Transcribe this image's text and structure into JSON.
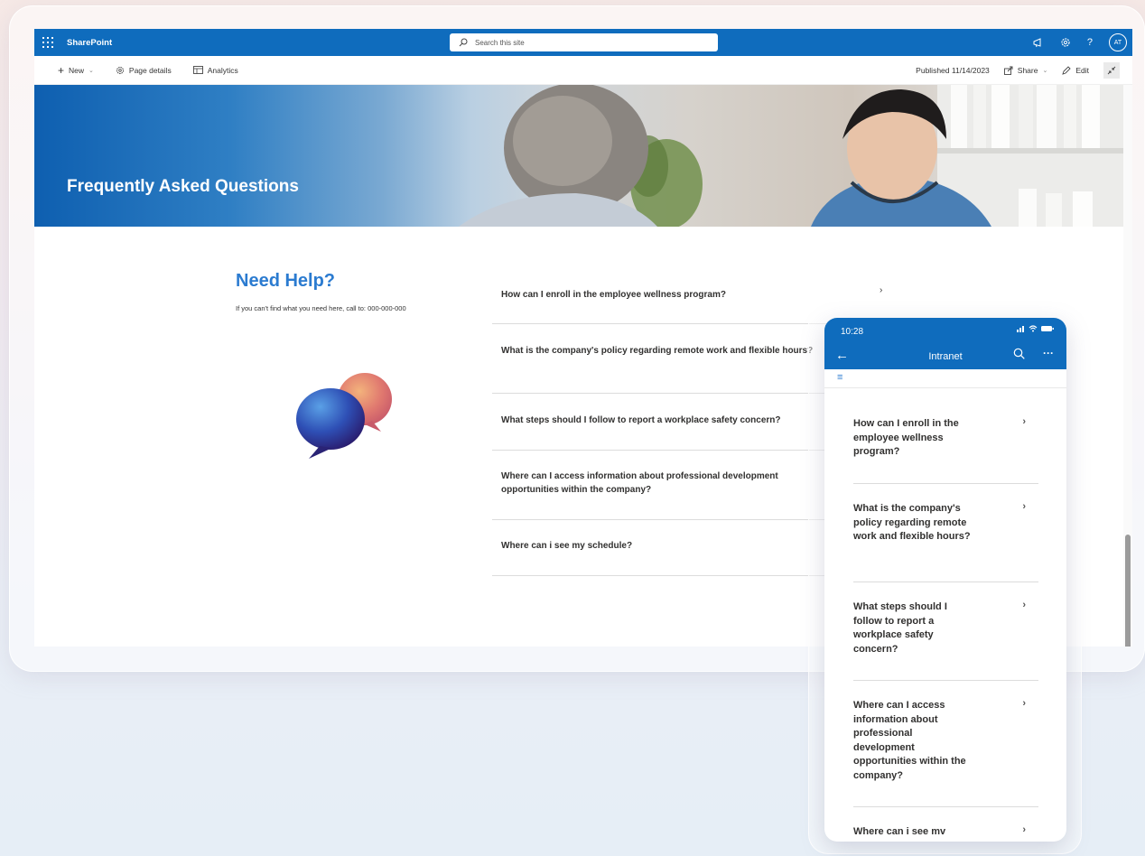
{
  "suite_bar": {
    "app_name": "SharePoint",
    "search_placeholder": "Search this site",
    "avatar_initials": "AT",
    "help_glyph": "?"
  },
  "command_bar": {
    "new_label": "New",
    "page_details_label": "Page details",
    "analytics_label": "Analytics",
    "published_label": "Published 11/14/2023",
    "share_label": "Share",
    "edit_label": "Edit"
  },
  "hero": {
    "title": "Frequently Asked Questions"
  },
  "help": {
    "title": "Need Help?",
    "subtitle": "If you can't find what you need here, call to:  000-000-000"
  },
  "faq": {
    "items": [
      {
        "question": "How can I enroll in the employee wellness program?"
      },
      {
        "question": "What is the company's policy regarding remote work and flexible hours?"
      },
      {
        "question": "What steps should I follow to report a workplace safety concern?"
      },
      {
        "question": "Where can I access information about professional development opportunities within the company?"
      },
      {
        "question": "Where can i see my schedule?"
      }
    ],
    "first_item_chevron": "›"
  },
  "phone": {
    "time": "10:28",
    "title": "Intranet",
    "items": [
      {
        "question": "How can I enroll in the employee wellness program?"
      },
      {
        "question": "What is the company's policy regarding remote work and flexible hours?"
      },
      {
        "question": "What steps should I follow to report a workplace safety concern?"
      },
      {
        "question": "Where can I access information about professional development opportunities within the company?"
      },
      {
        "question": "Where can i see mv"
      }
    ]
  },
  "colors": {
    "brand": "#0f6cbd",
    "accent_text": "#2b7bd0"
  }
}
